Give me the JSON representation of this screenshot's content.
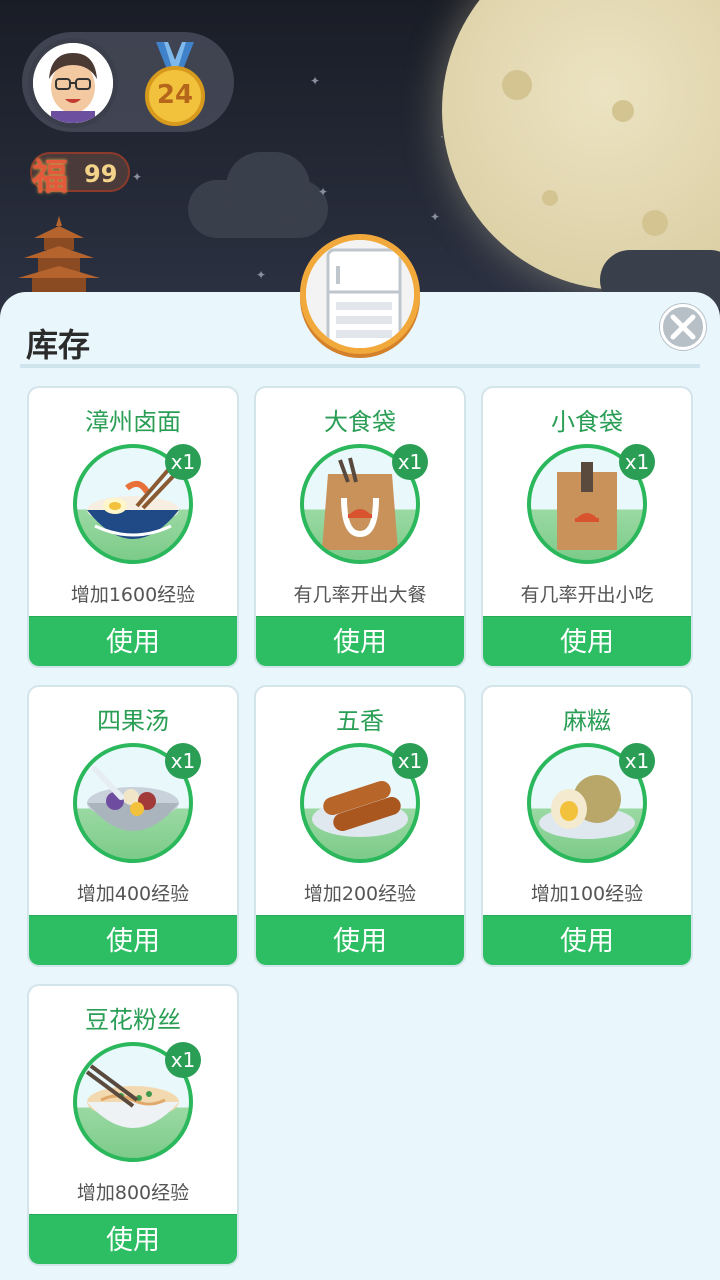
{
  "header": {
    "level": "24",
    "fu_char": "福",
    "fu_count": "99"
  },
  "panel": {
    "title": "库存",
    "close_icon": "close-icon",
    "header_icon": "fridge-icon"
  },
  "inventory": [
    {
      "name": "漳州卤面",
      "qty": "x1",
      "desc": "增加1600经验",
      "action": "使用",
      "icon": "noodle-bowl-icon"
    },
    {
      "name": "大食袋",
      "qty": "x1",
      "desc": "有几率开出大餐",
      "action": "使用",
      "icon": "large-food-bag-icon"
    },
    {
      "name": "小食袋",
      "qty": "x1",
      "desc": "有几率开出小吃",
      "action": "使用",
      "icon": "small-food-bag-icon"
    },
    {
      "name": "四果汤",
      "qty": "x1",
      "desc": "增加400经验",
      "action": "使用",
      "icon": "fruit-soup-icon"
    },
    {
      "name": "五香",
      "qty": "x1",
      "desc": "增加200经验",
      "action": "使用",
      "icon": "five-spice-roll-icon"
    },
    {
      "name": "麻糍",
      "qty": "x1",
      "desc": "增加100经验",
      "action": "使用",
      "icon": "mochi-icon"
    },
    {
      "name": "豆花粉丝",
      "qty": "x1",
      "desc": "增加800经验",
      "action": "使用",
      "icon": "vermicelli-bowl-icon"
    }
  ],
  "colors": {
    "accent_green": "#2dbe63",
    "title_green": "#2a9e55",
    "panel_bg": "#e9f6fb",
    "badge_orange": "#f2a93b"
  }
}
